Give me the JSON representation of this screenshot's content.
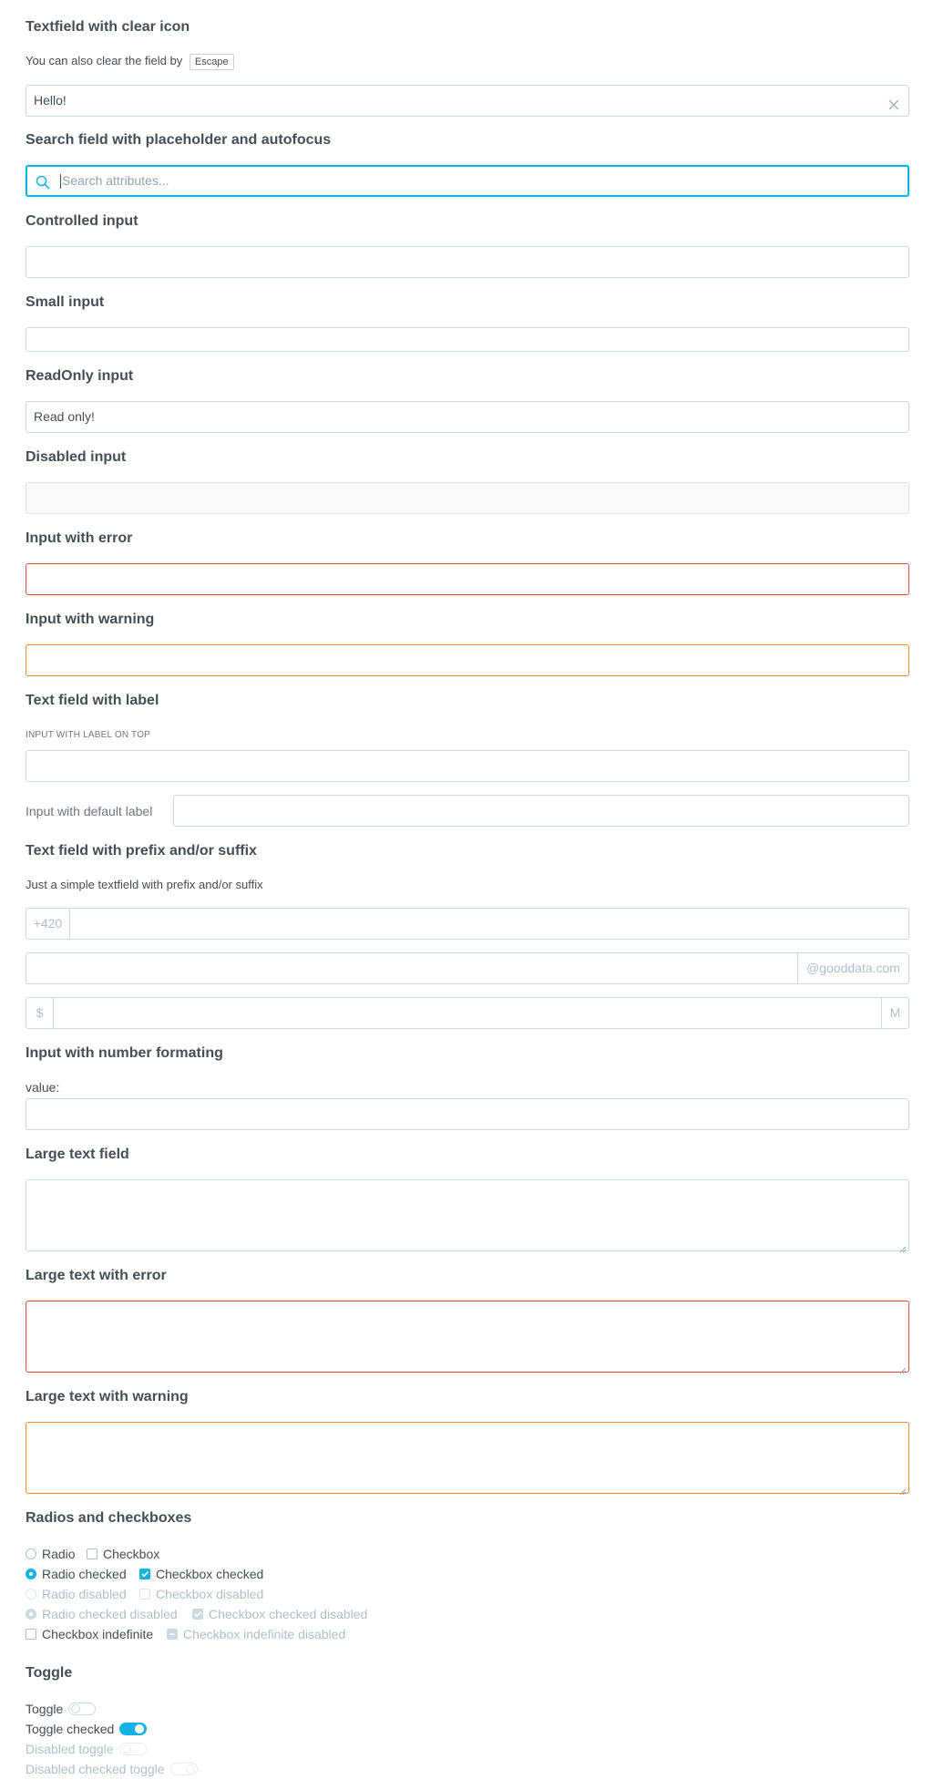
{
  "clear_section": {
    "heading": "Textfield with clear icon",
    "desc": "You can also clear the field by",
    "key": "Escape",
    "value": "Hello!"
  },
  "search_section": {
    "heading": "Search field with placeholder and autofocus",
    "placeholder": "Search attributes..."
  },
  "controlled": {
    "heading": "Controlled input"
  },
  "small": {
    "heading": "Small input"
  },
  "readonly": {
    "heading": "ReadOnly input",
    "value": "Read only!"
  },
  "disabled": {
    "heading": "Disabled input"
  },
  "error": {
    "heading": "Input with error"
  },
  "warning": {
    "heading": "Input with warning"
  },
  "label_section": {
    "heading": "Text field with label",
    "top_label": "INPUT WITH LABEL ON TOP",
    "side_label": "Input with default label"
  },
  "affix_section": {
    "heading": "Text field with prefix and/or suffix",
    "desc": "Just a simple textfield with prefix and/or suffix",
    "prefix_phone": "+420",
    "suffix_domain": "@gooddata.com",
    "prefix_currency": "$",
    "suffix_unit": "M"
  },
  "number_section": {
    "heading": "Input with number formating",
    "label": "value:"
  },
  "large": {
    "heading": "Large text field"
  },
  "large_error": {
    "heading": "Large text with error"
  },
  "large_warning": {
    "heading": "Large text with warning"
  },
  "checks": {
    "heading": "Radios and checkboxes",
    "radio": "Radio",
    "checkbox": "Checkbox",
    "radio_checked": "Radio checked",
    "checkbox_checked": "Checkbox checked",
    "radio_disabled": "Radio disabled",
    "checkbox_disabled": "Checkbox disabled",
    "radio_checked_disabled": "Radio checked disabled",
    "checkbox_checked_disabled": "Checkbox checked disabled",
    "checkbox_indefinite": "Checkbox indefinite",
    "checkbox_indefinite_disabled": "Checkbox indefinite disabled"
  },
  "toggles": {
    "heading": "Toggle",
    "toggle": "Toggle",
    "toggle_checked": "Toggle checked",
    "disabled_toggle": "Disabled toggle",
    "disabled_checked_toggle": "Disabled checked toggle"
  },
  "colors": {
    "accent": "#14b2e2",
    "error": "#e54d42",
    "warning": "#f38c31",
    "border": "#ccd8e2"
  }
}
